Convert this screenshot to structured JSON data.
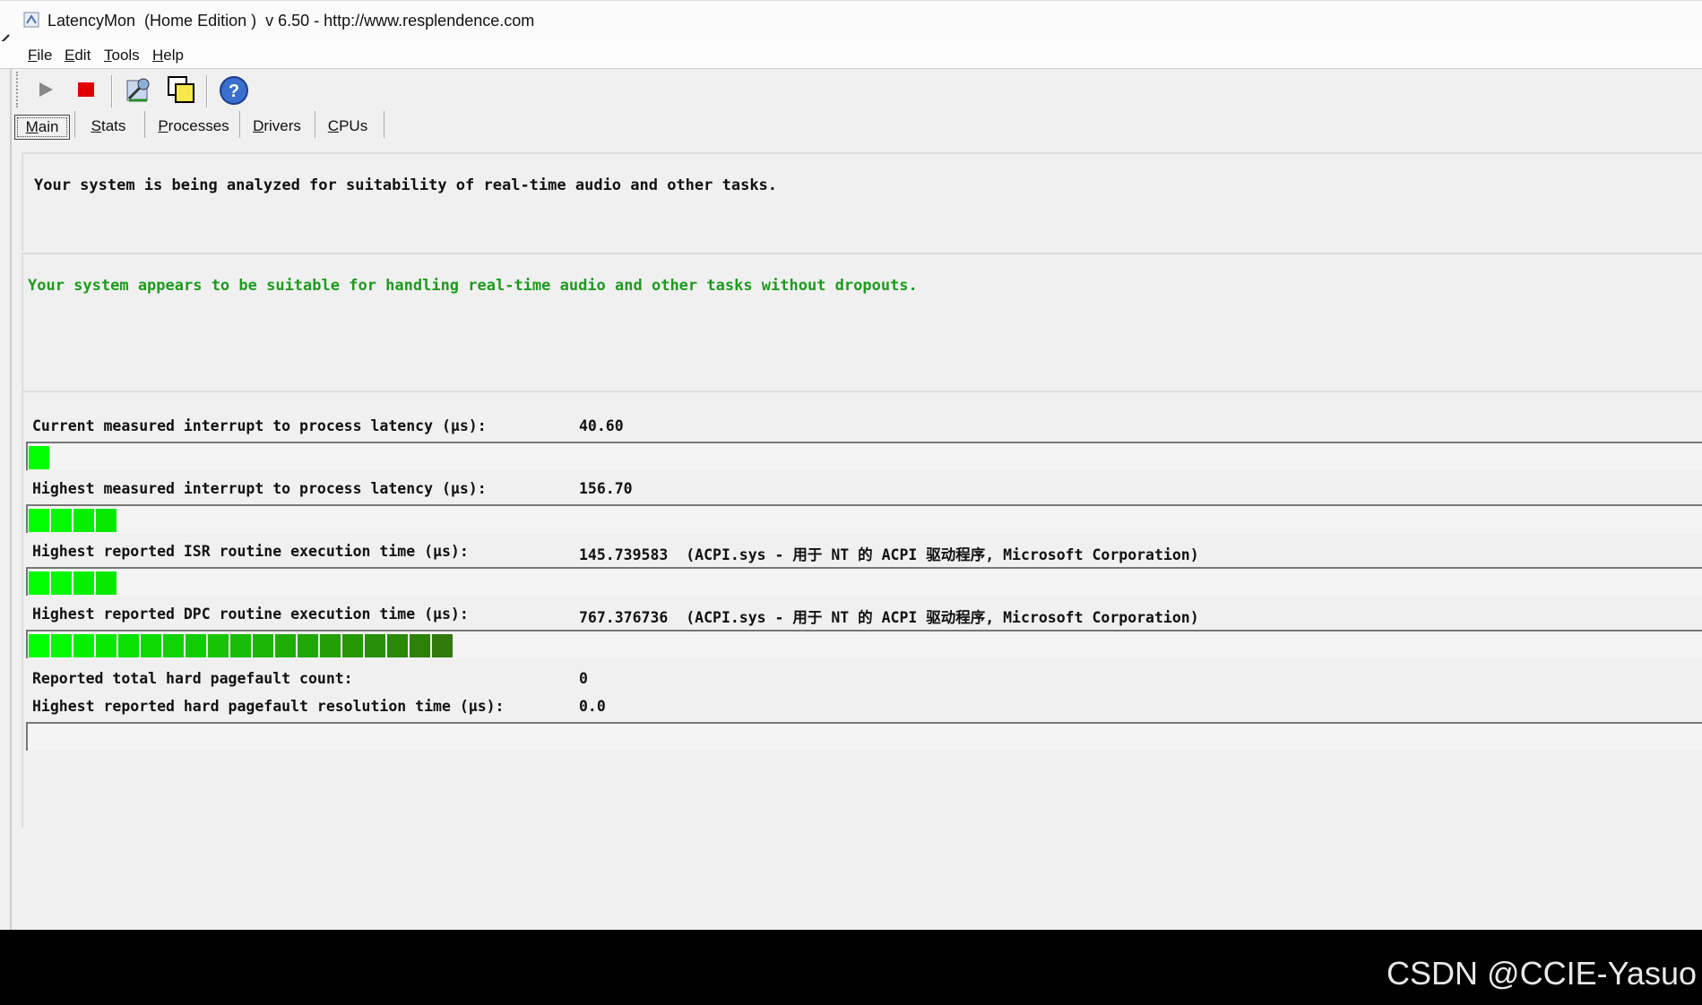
{
  "window": {
    "title": "LatencyMon  (Home Edition )  v 6.50 - http://www.resplendence.com"
  },
  "menu": [
    {
      "u": "F",
      "rest": "ile"
    },
    {
      "u": "E",
      "rest": "dit"
    },
    {
      "u": "T",
      "rest": "ools"
    },
    {
      "u": "H",
      "rest": "elp"
    }
  ],
  "toolbar": {
    "icons": [
      "play-icon",
      "stop-icon",
      "analyze-tools-icon",
      "windows-icon",
      "help-icon"
    ]
  },
  "tabs": [
    {
      "u": "M",
      "rest": "ain",
      "active": true
    },
    {
      "u": "S",
      "rest": "tats",
      "active": false
    },
    {
      "u": "P",
      "rest": "rocesses",
      "active": false
    },
    {
      "u": "D",
      "rest": "rivers",
      "active": false
    },
    {
      "u": "C",
      "rest": "PUs",
      "active": false
    }
  ],
  "main": {
    "status_message": "Your system is being analyzed for suitability of real-time audio and other tasks.",
    "result_message": "Your system appears to be suitable for handling real-time audio and other tasks without dropouts.",
    "result_color": "#1e9a1e",
    "metrics": [
      {
        "label": "Current measured interrupt to process latency (µs):",
        "value": "40.60",
        "meter_segments": 1
      },
      {
        "label": "Highest measured interrupt to process latency (µs):",
        "value": "156.70",
        "meter_segments": 4
      },
      {
        "label": "Highest reported ISR routine execution time (µs):",
        "value": "145.739583  (ACPI.sys - 用于 NT 的 ACPI 驱动程序, Microsoft Corporation)",
        "meter_segments": 4
      },
      {
        "label": "Highest reported DPC routine execution time (µs):",
        "value": "767.376736  (ACPI.sys - 用于 NT 的 ACPI 驱动程序, Microsoft Corporation)",
        "meter_segments": 19
      },
      {
        "label": "Reported total hard pagefault count:",
        "value": "0",
        "meter_segments": null
      },
      {
        "label": "Highest reported hard pagefault resolution time (µs):",
        "value": "0.0",
        "meter_segments": 0
      }
    ]
  },
  "watermark": "CSDN @CCIE-Yasuo"
}
